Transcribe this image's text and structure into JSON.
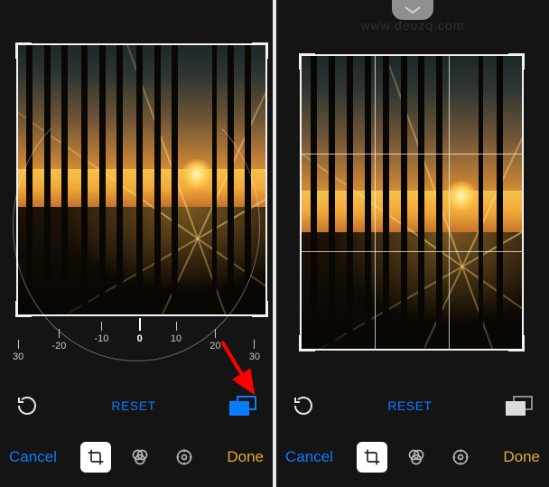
{
  "watermark": "www.deuzq.com",
  "left": {
    "dial_ticks": [
      "30",
      "-20",
      "-10",
      "0",
      "10",
      "20",
      "30"
    ],
    "toolbar": {
      "reset": "RESET",
      "rotate_icon": "rotate-ccw-icon",
      "aspect_icon": "aspect-ratio-icon",
      "aspect_active": true
    },
    "bottom": {
      "cancel": "Cancel",
      "done": "Done",
      "modes": {
        "crop": "crop-icon",
        "filters": "filters-icon",
        "adjust": "adjust-icon"
      },
      "active_mode": "crop"
    },
    "crop": {
      "show_grid": false
    }
  },
  "right": {
    "pull_tab_icon": "chevron-down-icon",
    "toolbar": {
      "reset": "RESET",
      "rotate_icon": "rotate-ccw-icon",
      "aspect_icon": "aspect-ratio-icon",
      "aspect_active": false
    },
    "bottom": {
      "cancel": "Cancel",
      "done": "Done",
      "modes": {
        "crop": "crop-icon",
        "filters": "filters-icon",
        "adjust": "adjust-icon"
      },
      "active_mode": "crop"
    },
    "crop": {
      "show_grid": true
    }
  },
  "annotation": {
    "arrow_color": "#ff0000",
    "meaning": "points to aspect-ratio button"
  },
  "colors": {
    "accent_blue": "#0a7cff",
    "accent_orange": "#e2a93a",
    "background": "#141414"
  }
}
